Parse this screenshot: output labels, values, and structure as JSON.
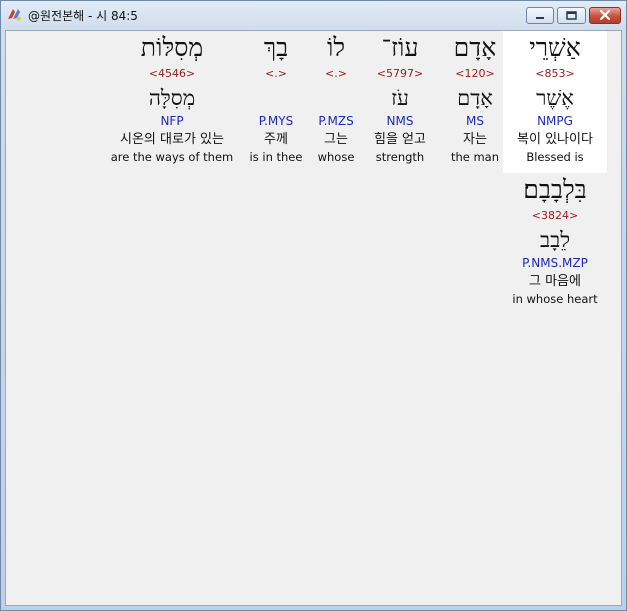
{
  "window": {
    "title": "@원전본해 - 시 84:5",
    "icon": "app-logo-icon",
    "controls": [
      "minimize-icon",
      "maximize-icon",
      "close-icon"
    ]
  },
  "colors": {
    "strong_number": "#9b1b1b",
    "morphology": "#1d2ab8",
    "text": "#111111",
    "highlight_bg": "#ffffff",
    "panel_bg": "#f0f0f0"
  },
  "words": [
    {
      "hebrew": "אַשְׁרֵי",
      "strong": "<853>",
      "lemma": "אֶשֶׁר",
      "morph": "NMPG",
      "korean": "복이 있나이다",
      "english": "Blessed is",
      "selected": true
    },
    {
      "hebrew": "אָדָם",
      "strong": "<120>",
      "lemma": "אָדָם",
      "morph": "MS",
      "korean": "자는",
      "english": "the man",
      "selected": false
    },
    {
      "hebrew": "עוֹז־",
      "strong": "<5797>",
      "lemma": "עֹז",
      "morph": "NMS",
      "korean": "힘을 얻고",
      "english": "strength",
      "selected": false
    },
    {
      "hebrew": "לוֹ",
      "strong": "<.>",
      "lemma": "",
      "morph": "P.MZS",
      "korean": "그는",
      "english": "whose",
      "selected": false
    },
    {
      "hebrew": "בָךְ",
      "strong": "<.>",
      "lemma": "",
      "morph": "P.MYS",
      "korean": "주께",
      "english": "is in thee",
      "selected": false
    },
    {
      "hebrew": "מְסִלּוֹת",
      "strong": "<4546>",
      "lemma": "מְסִלָּה",
      "morph": "NFP",
      "korean": "시온의 대로가 있는",
      "english": "are the ways of them",
      "selected": false
    },
    {
      "hebrew": "בִּלְבָבָם׃",
      "strong": "<3824>",
      "lemma": "לֵבָב",
      "morph": "P.NMS.MZP",
      "korean": "그 마음에",
      "english": "in whose heart",
      "selected": false
    }
  ]
}
